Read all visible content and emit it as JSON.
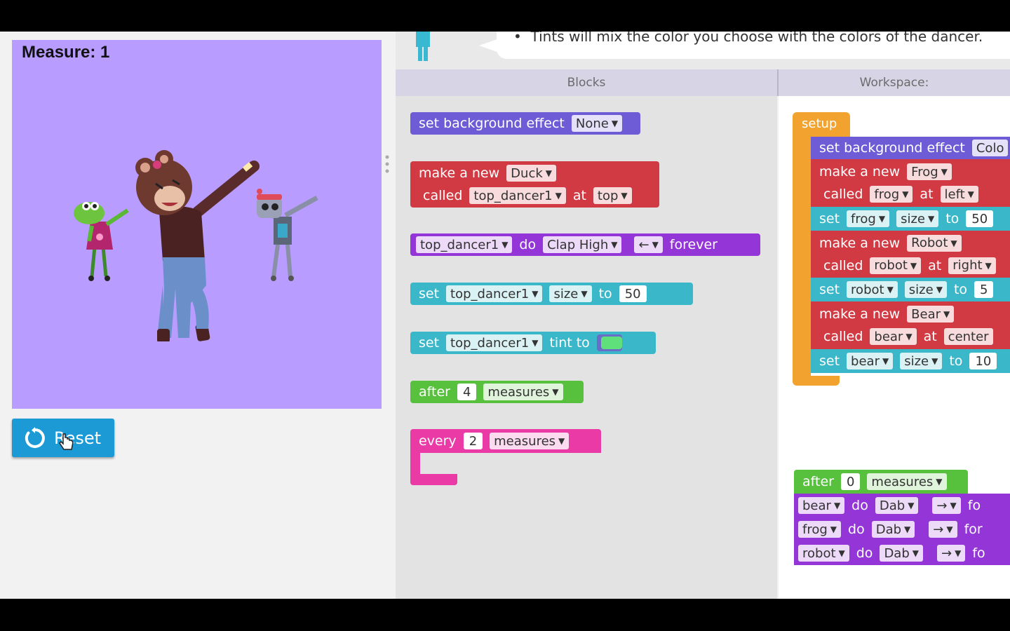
{
  "stage": {
    "measure_text": "Measure: 1",
    "background": "#b89cff",
    "reset_label": "Reset"
  },
  "instructions": {
    "hint": "Tints will mix the color you choose with the colors of the dancer."
  },
  "panels": {
    "blocks_title": "Blocks",
    "workspace_title": "Workspace:"
  },
  "toolbox": {
    "bg_effect": {
      "text": "set background effect",
      "value": "None"
    },
    "make_new": {
      "t1": "make a new",
      "type": "Duck",
      "t2": "called",
      "name": "top_dancer1",
      "t3": "at",
      "pos": "top"
    },
    "do_forever": {
      "sprite": "top_dancer1",
      "t1": "do",
      "move": "Clap High",
      "dir": "←",
      "t2": "forever"
    },
    "set_size": {
      "t1": "set",
      "sprite": "top_dancer1",
      "prop": "size",
      "t2": "to",
      "value": "50"
    },
    "set_tint": {
      "t1": "set",
      "sprite": "top_dancer1",
      "t2": "tint to",
      "color": "#5fe07a"
    },
    "after": {
      "t1": "after",
      "value": "4",
      "unit": "measures"
    },
    "every": {
      "t1": "every",
      "value": "2",
      "unit": "measures"
    }
  },
  "workspace": {
    "setup_label": "setup",
    "bg_effect": {
      "text": "set background effect",
      "value": "Colo"
    },
    "frog_make": {
      "t1": "make a new",
      "type": "Frog",
      "t2": "called",
      "name": "frog",
      "t3": "at",
      "pos": "left"
    },
    "frog_size": {
      "t1": "set",
      "sprite": "frog",
      "prop": "size",
      "t2": "to",
      "value": "50"
    },
    "robot_make": {
      "t1": "make a new",
      "type": "Robot",
      "t2": "called",
      "name": "robot",
      "t3": "at",
      "pos": "right"
    },
    "robot_size": {
      "t1": "set",
      "sprite": "robot",
      "prop": "size",
      "t2": "to",
      "value": "5"
    },
    "bear_make": {
      "t1": "make a new",
      "type": "Bear",
      "t2": "called",
      "name": "bear",
      "t3": "at",
      "pos": "center"
    },
    "bear_size": {
      "t1": "set",
      "sprite": "bear",
      "prop": "size",
      "t2": "to",
      "value": "10"
    },
    "after": {
      "t1": "after",
      "value": "0",
      "unit": "measures"
    },
    "dances": [
      {
        "sprite": "bear",
        "t1": "do",
        "move": "Dab",
        "dir": "→",
        "t2": "fo"
      },
      {
        "sprite": "frog",
        "t1": "do",
        "move": "Dab",
        "dir": "→",
        "t2": "for"
      },
      {
        "sprite": "robot",
        "t1": "do",
        "move": "Dab",
        "dir": "→",
        "t2": "fo"
      }
    ]
  },
  "colors": {
    "purple_block": "#6e5bd6",
    "red_block": "#d23a43",
    "violet_block": "#9435d7",
    "teal_block": "#3ab7c8",
    "green_block": "#57c13e",
    "pink_block": "#e93aa6",
    "orange_block": "#f2a22e",
    "reset_button": "#1b9ad6"
  }
}
